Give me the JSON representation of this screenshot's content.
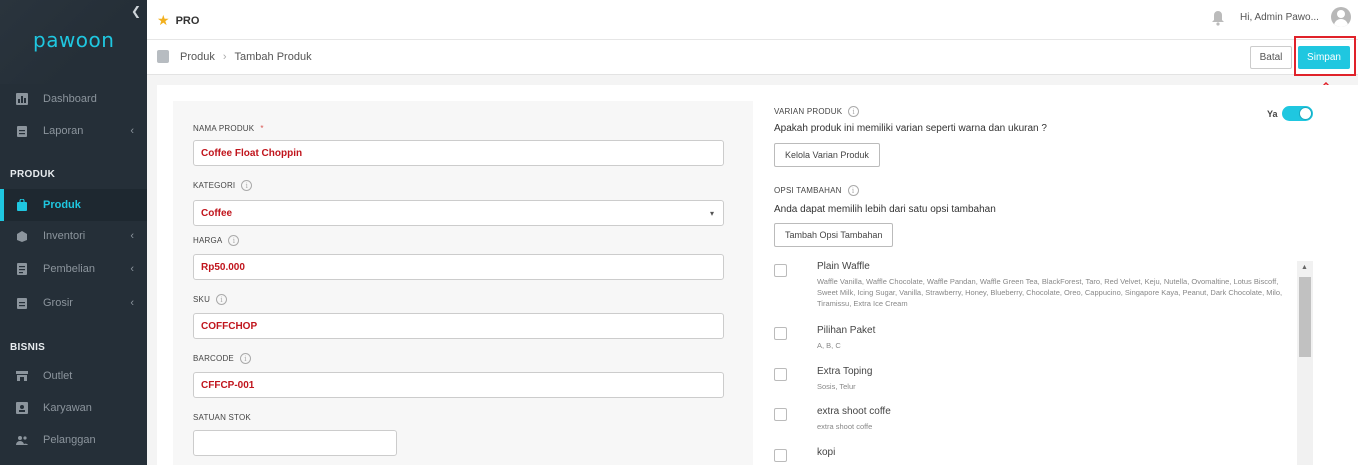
{
  "sidebar": {
    "brand": "pawoon",
    "collapse_icon": "chevron-left",
    "items": [
      {
        "label": "Dashboard",
        "icon": "bar-chart-icon",
        "chevron": ""
      },
      {
        "label": "Laporan",
        "icon": "clipboard-icon",
        "chevron": "‹"
      },
      {
        "label": "Produk",
        "icon": "bag-icon",
        "chevron": ""
      },
      {
        "label": "Inventori",
        "icon": "box-icon",
        "chevron": "‹"
      },
      {
        "label": "Pembelian",
        "icon": "document-icon",
        "chevron": "‹"
      },
      {
        "label": "Grosir",
        "icon": "clipboard-icon",
        "chevron": "‹"
      },
      {
        "label": "Outlet",
        "icon": "store-icon",
        "chevron": ""
      },
      {
        "label": "Karyawan",
        "icon": "id-card-icon",
        "chevron": ""
      },
      {
        "label": "Pelanggan",
        "icon": "people-icon",
        "chevron": ""
      }
    ],
    "sections": {
      "produk": "PRODUK",
      "bisnis": "BISNIS"
    }
  },
  "topbar": {
    "plan": "PRO",
    "greeting": "Hi, Admin Pawo..."
  },
  "breadcrumb": {
    "first": "Produk",
    "sep": "›",
    "second": "Tambah Produk"
  },
  "actions": {
    "cancel": "Batal",
    "save": "Simpan"
  },
  "form": {
    "name_label": "NAMA PRODUK",
    "required_mark": "*",
    "name_value": "Coffee Float Choppin",
    "category_label": "KATEGORI",
    "category_value": "Coffee",
    "price_label": "HARGA",
    "price_value": "Rp50.000",
    "sku_label": "SKU",
    "sku_value": "COFFCHOP",
    "barcode_label": "BARCODE",
    "barcode_value": "CFFCP-001",
    "unit_label": "SATUAN STOK",
    "unit_value": ""
  },
  "variant": {
    "label": "VARIAN PRODUK",
    "question": "Apakah produk ini memiliki varian seperti warna dan ukuran ?",
    "button": "Kelola Varian Produk",
    "toggle_label": "Ya",
    "toggle_on": true
  },
  "addons": {
    "label": "OPSI TAMBAHAN",
    "hint": "Anda dapat memilih lebih dari satu opsi tambahan",
    "button": "Tambah Opsi Tambahan",
    "options": [
      {
        "name": "Plain Waffle",
        "detail": "Waffle Vanilla, Waffle Chocolate, Waffle Pandan, Waffle Green Tea, BlackForest, Taro, Red Velvet, Keju, Nutella, Ovomaltine, Lotus Biscoff, Sweet Milk, Icing Sugar, Vanilla, Strawberry, Honey, Blueberry, Chocolate, Oreo, Cappucino, Singapore Kaya, Peanut, Dark Chocolate, Milo, Tiramissu, Extra Ice Cream"
      },
      {
        "name": "Pilihan Paket",
        "detail": "A, B, C"
      },
      {
        "name": "Extra Toping",
        "detail": "Sosis, Telur"
      },
      {
        "name": "extra shoot coffe",
        "detail": "extra shoot coffe"
      },
      {
        "name": "kopi",
        "detail": ""
      }
    ]
  },
  "colors": {
    "accent": "#1fc7e0",
    "sidebar_bg": "#252f38",
    "value_text": "#c0141c",
    "highlight": "#e0222a"
  }
}
